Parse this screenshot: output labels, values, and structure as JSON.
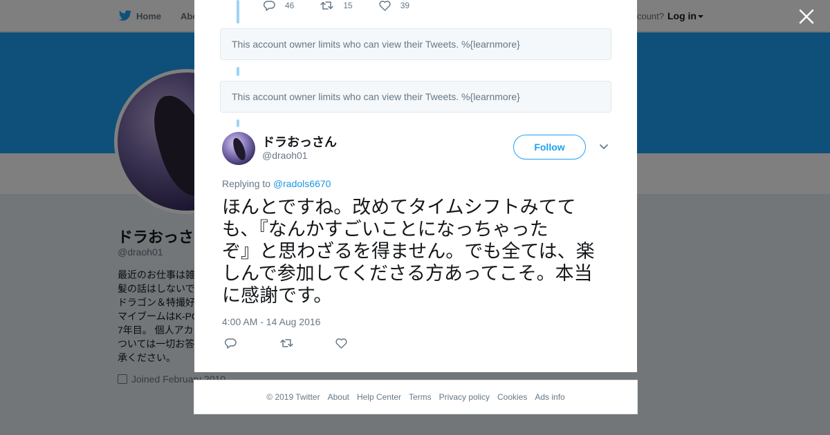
{
  "background": {
    "nav": {
      "home_label": "Home",
      "about_label": "Abo",
      "have_account": "ccount?",
      "login_label": "Log in"
    },
    "profile": {
      "name": "ドラおっさ",
      "handle": "@draoh01",
      "bio_lines": [
        "最近のお仕事は雑",
        "髪の話はしないで",
        "ドラゴン＆特撮好",
        "マイブームはK-PO",
        "7年目。 個人アカ",
        "ついては一切お答",
        "承ください。"
      ],
      "joined": "Joined February 2010"
    }
  },
  "top_actions": {
    "replies": "46",
    "retweets": "15",
    "likes": "39"
  },
  "limit_notice_1": "This account owner limits who can view their Tweets. %{learnmore}",
  "limit_notice_2": "This account owner limits who can view their Tweets. %{learnmore}",
  "tweet": {
    "name": "ドラおっさん",
    "handle": "@draoh01",
    "follow_label": "Follow",
    "replying_prefix": "Replying to",
    "replying_to": "@radols6670",
    "text_lines": [
      "ほんとですね。改めてタイムシフトみてて",
      "も、『なんかすごいことになっちゃった",
      "ぞ』と思わざるを得ません。でも全ては、楽",
      "しんで参加してくださる方あってこそ。本当",
      "に感謝です。"
    ],
    "timestamp": "4:00 AM - 14 Aug 2016"
  },
  "footer": {
    "copyright": "© 2019 Twitter",
    "links": [
      "About",
      "Help Center",
      "Terms",
      "Privacy policy",
      "Cookies",
      "Ads info"
    ]
  },
  "colors": {
    "brand": "#1da1f2",
    "thread_line": "#9ed3f6",
    "muted": "#657786"
  }
}
